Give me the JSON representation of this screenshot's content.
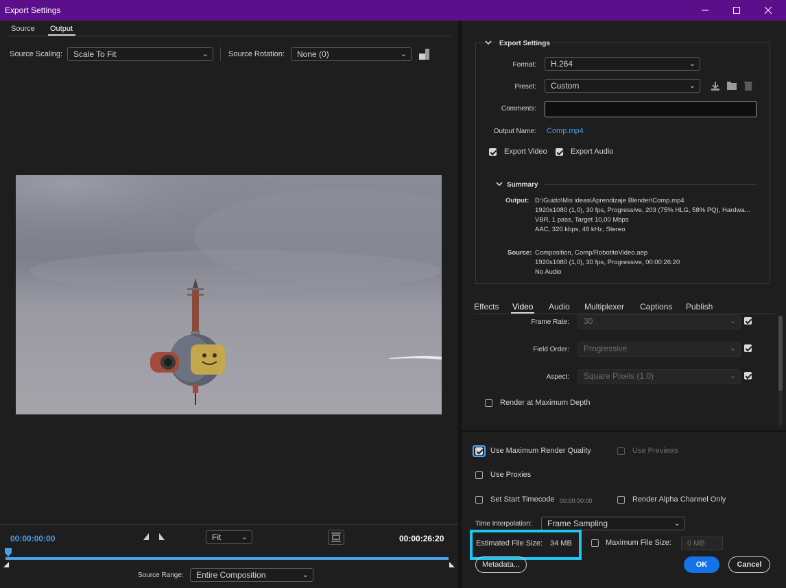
{
  "window": {
    "title": "Export Settings",
    "minimize_icon": "minimize-icon",
    "maximize_icon": "maximize-icon",
    "close_icon": "close-icon",
    "title_color": "#5c0f8b"
  },
  "left": {
    "tabs": [
      "Source",
      "Output"
    ],
    "active_tab": "Output",
    "source_scaling_label": "Source Scaling:",
    "source_scaling_value": "Scale To Fit",
    "source_rotation_label": "Source Rotation:",
    "source_rotation_value": "None (0)",
    "timecode_start": "00:00:00:00",
    "timecode_end": "00:00:26:20",
    "zoom_value": "Fit",
    "source_range_label": "Source Range:",
    "source_range_value": "Entire Composition",
    "timecode_color": "#4a9fe8"
  },
  "export_settings": {
    "header": "Export Settings",
    "format_label": "Format:",
    "format_value": "H.264",
    "preset_label": "Preset:",
    "preset_value": "Custom",
    "comments_label": "Comments:",
    "comments_value": "",
    "output_name_label": "Output Name:",
    "output_name_value": "Comp.mp4",
    "export_video_label": "Export Video",
    "export_video_checked": true,
    "export_audio_label": "Export Audio",
    "export_audio_checked": true,
    "summary_header": "Summary",
    "output_key": "Output:",
    "output_lines": [
      "D:\\Guido\\Mis ideas\\Aprendizaje Blender\\Comp.mp4",
      "1920x1080 (1,0), 30 fps, Progressive, 203 (75% HLG, 58% PQ), Hardwa...",
      "VBR, 1 pass, Target 10,00 Mbps",
      "AAC, 320 kbps, 48 kHz, Stereo"
    ],
    "source_key": "Source:",
    "source_lines": [
      "Composition, Comp/RobotitoVideo.aep",
      "1920x1080 (1,0), 30 fps, Progressive, 00:00:26:20",
      "No Audio"
    ]
  },
  "detail_tabs": {
    "items": [
      "Effects",
      "Video",
      "Audio",
      "Multiplexer",
      "Captions",
      "Publish"
    ],
    "active": "Video"
  },
  "video_settings": {
    "frame_rate_label": "Frame Rate:",
    "frame_rate_value": "30",
    "field_order_label": "Field Order:",
    "field_order_value": "Progressive",
    "aspect_label": "Aspect:",
    "aspect_value": "Square Pixels (1.0)",
    "render_max_depth_label": "Render at Maximum Depth"
  },
  "bottom": {
    "use_max_render_quality_label": "Use Maximum Render Quality",
    "use_previews_label": "Use Previews",
    "use_proxies_label": "Use Proxies",
    "set_start_timecode_label": "Set Start Timecode",
    "start_timecode_value": "00:00:00:00",
    "render_alpha_label": "Render Alpha Channel Only",
    "time_interpolation_label": "Time Interpolation:",
    "time_interpolation_value": "Frame Sampling",
    "estimated_file_size_label": "Estimated File Size:",
    "estimated_file_size_value": "34 MB",
    "maximum_file_size_label": "Maximum File Size:",
    "maximum_file_size_value": "0 MB",
    "metadata_button": "Metadata...",
    "ok_button": "OK",
    "cancel_button": "Cancel",
    "ok_color": "#1473e6",
    "highlight_color": "#1fc5f0"
  }
}
